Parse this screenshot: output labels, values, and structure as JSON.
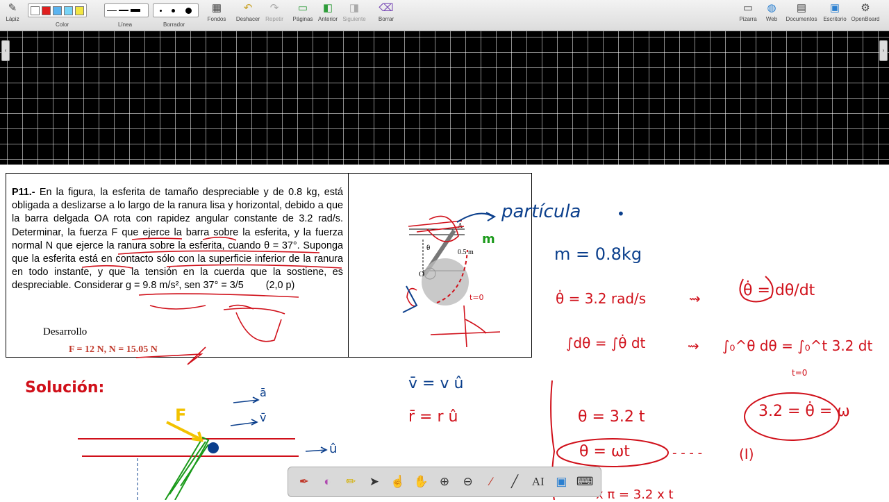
{
  "toolbar": {
    "left": [
      {
        "label": "Lápiz",
        "icon": "pencil-icon",
        "glyph": "✎"
      }
    ],
    "color_label": "Color",
    "colors": [
      "#ffffff",
      "#e01f1f",
      "#5ab4f0",
      "#77d4f7",
      "#f2e642"
    ],
    "line_label": "Línea",
    "eraser_label": "Borrador",
    "tools": [
      {
        "label": "Fondos",
        "icon": "background-icon",
        "glyph": "▦"
      },
      {
        "label": "Deshacer",
        "icon": "undo-icon",
        "glyph": "↶"
      },
      {
        "label": "Repetir",
        "icon": "redo-icon",
        "glyph": "↷"
      },
      {
        "label": "Páginas",
        "icon": "pages-icon",
        "glyph": "▭"
      },
      {
        "label": "Anterior",
        "icon": "previous-icon",
        "glyph": "◧"
      },
      {
        "label": "Siguiente",
        "icon": "next-icon",
        "glyph": "◨"
      },
      {
        "label": "Borrar",
        "icon": "clear-icon",
        "glyph": "⌫"
      }
    ],
    "right": [
      {
        "label": "Pizarra",
        "icon": "board-icon",
        "glyph": "▭"
      },
      {
        "label": "Web",
        "icon": "globe-icon",
        "glyph": "◍"
      },
      {
        "label": "Documentos",
        "icon": "folder-icon",
        "glyph": "▤"
      },
      {
        "label": "Escritorio",
        "icon": "desktop-icon",
        "glyph": "▣"
      },
      {
        "label": "OpenBoard",
        "icon": "settings-icon",
        "glyph": "⚙"
      }
    ]
  },
  "problem": {
    "id": "P11.-",
    "text": "En la figura, la esferita de tamaño despreciable y de 0.8 kg, está obligada a deslizarse a lo largo de la ranura lisa y horizontal, debido a que la barra delgada OA rota con rapidez angular constante de 3.2 rad/s. Determinar, la fuerza F que ejerce la barra sobre la esferita, y la fuerza normal N que ejerce la ranura sobre la esferita, cuando θ = 37°. Suponga que la esferita está en contacto sólo con la superficie inferior de la ranura en todo instante, y que la tensión en la cuerda que la sostiene, es despreciable. Considerar g = 9.8 m/s², sen 37° = 3/5",
    "points": "(2,0 p)",
    "dev_label": "Desarrollo",
    "answer": "F = 12 N, N = 15.05 N",
    "fig_labels": {
      "A": "A",
      "theta": "θ",
      "o": "O",
      "len": "0.5 m"
    }
  },
  "annotations": {
    "particula": "partícula",
    "m": "m",
    "mass": "m = 0.8kg",
    "theta_dot": "θ̇ = 3.2 rad/s",
    "theta_dot_def": "θ̇ = dθ/dt",
    "integral": "∫dθ = ∫θ̇ dt",
    "def_integral": "∫₀^θ dθ = ∫₀^t 3.2 dt",
    "theta_eq": "θ = 3.2 t",
    "omega_eq": "3.2 = θ̇ = ω",
    "wt_eq": "θ = ωt",
    "eq_num": "(I)",
    "solucion": "Solución:",
    "vel": "v̄ = v û",
    "pos": "r̄ = r û",
    "a_vec": "ā",
    "v_vec": "v̄",
    "u_vec": "û",
    "F": "F",
    "bottom_eq": "x π = 3.2 x t",
    "t0": "t=0",
    "t_eq": "t=0"
  },
  "palette": {
    "tools": [
      {
        "icon": "pen-icon",
        "glyph": "✒"
      },
      {
        "icon": "eraser-icon",
        "glyph": "◐"
      },
      {
        "icon": "marker-icon",
        "glyph": "✏"
      },
      {
        "icon": "pointer-icon",
        "glyph": "➤"
      },
      {
        "icon": "laser-icon",
        "glyph": "☝"
      },
      {
        "icon": "hand-icon",
        "glyph": "✋"
      },
      {
        "icon": "zoom-in-icon",
        "glyph": "⊕"
      },
      {
        "icon": "zoom-out-icon",
        "glyph": "⊖"
      },
      {
        "icon": "pipette-icon",
        "glyph": "⁄"
      },
      {
        "icon": "line-icon",
        "glyph": "╱"
      },
      {
        "icon": "text-icon",
        "glyph": "AI"
      },
      {
        "icon": "capture-icon",
        "glyph": "▣"
      },
      {
        "icon": "keyboard-icon",
        "glyph": "⌨"
      }
    ]
  }
}
